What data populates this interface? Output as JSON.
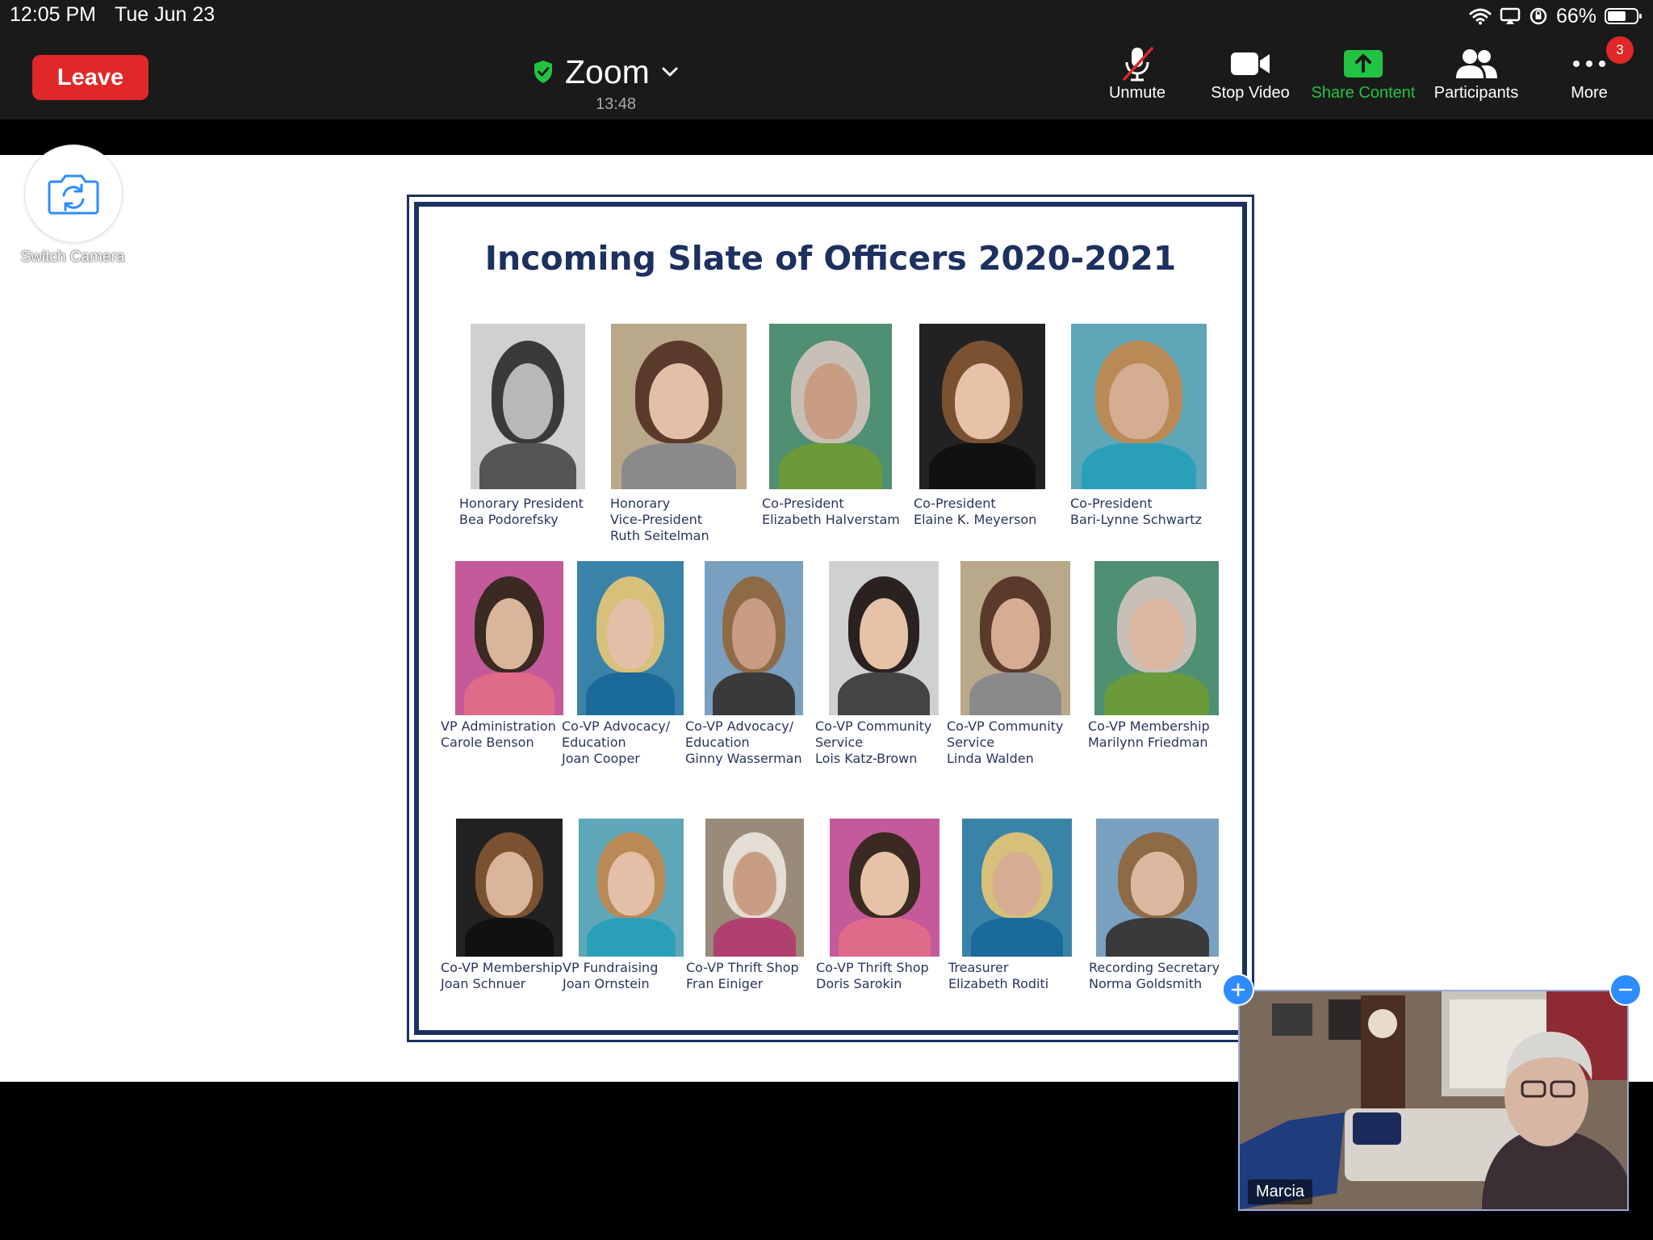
{
  "status_bar": {
    "time": "12:05 PM",
    "date": "Tue Jun 23",
    "battery_percent": "66%",
    "battery_level": 0.66
  },
  "toolbar": {
    "leave_label": "Leave",
    "meeting_name": "Zoom",
    "meeting_timer": "13:48",
    "buttons": [
      {
        "id": "unmute",
        "label": "Unmute",
        "icon": "mic-muted-icon"
      },
      {
        "id": "stop-video",
        "label": "Stop Video",
        "icon": "video-camera-icon"
      },
      {
        "id": "share-content",
        "label": "Share Content",
        "icon": "share-upload-icon"
      },
      {
        "id": "participants",
        "label": "Participants",
        "icon": "participants-icon"
      },
      {
        "id": "more",
        "label": "More",
        "icon": "more-dots-icon"
      }
    ],
    "more_badge": "3"
  },
  "switch_camera": {
    "label": "Switch Camera",
    "icon": "switch-camera-icon"
  },
  "slide": {
    "title": "Incoming Slate of Officers 2020-2021",
    "rows": [
      [
        {
          "lines": [
            "Honorary President",
            "Bea Podorefsky"
          ]
        },
        {
          "lines": [
            "Honorary",
            "Vice-President",
            "Ruth Seitelman"
          ]
        },
        {
          "lines": [
            "Co-President",
            "Elizabeth Halverstam"
          ]
        },
        {
          "lines": [
            "Co-President",
            "Elaine K. Meyerson"
          ]
        },
        {
          "lines": [
            "Co-President",
            "Bari-Lynne Schwartz"
          ]
        }
      ],
      [
        {
          "lines": [
            "VP Administration",
            "Carole Benson"
          ]
        },
        {
          "lines": [
            "Co-VP Advocacy/",
            "Education",
            "Joan Cooper"
          ]
        },
        {
          "lines": [
            "Co-VP Advocacy/",
            "Education",
            "Ginny Wasserman"
          ]
        },
        {
          "lines": [
            "Co-VP Community",
            "Service",
            "Lois Katz-Brown"
          ]
        },
        {
          "lines": [
            "Co-VP Community",
            "Service",
            "Linda Walden"
          ]
        },
        {
          "lines": [
            "Co-VP Membership",
            "Marilynn Friedman"
          ]
        }
      ],
      [
        {
          "lines": [
            "Co-VP Membership",
            "Joan Schnuer"
          ]
        },
        {
          "lines": [
            "VP Fundraising",
            "Joan Ornstein"
          ]
        },
        {
          "lines": [
            "Co-VP Thrift Shop",
            "Fran Einiger"
          ]
        },
        {
          "lines": [
            "Co-VP Thrift Shop",
            "Doris Sarokin"
          ]
        },
        {
          "lines": [
            "Treasurer",
            "Elizabeth Roditi"
          ]
        },
        {
          "lines": [
            "Recording Secretary",
            "Norma Goldsmith"
          ]
        }
      ]
    ]
  },
  "self_view": {
    "name": "Marcia"
  },
  "colors": {
    "leave": "#e02828",
    "share": "#21c442",
    "accent": "#2d8cff",
    "slide_navy": "#1d3160"
  }
}
